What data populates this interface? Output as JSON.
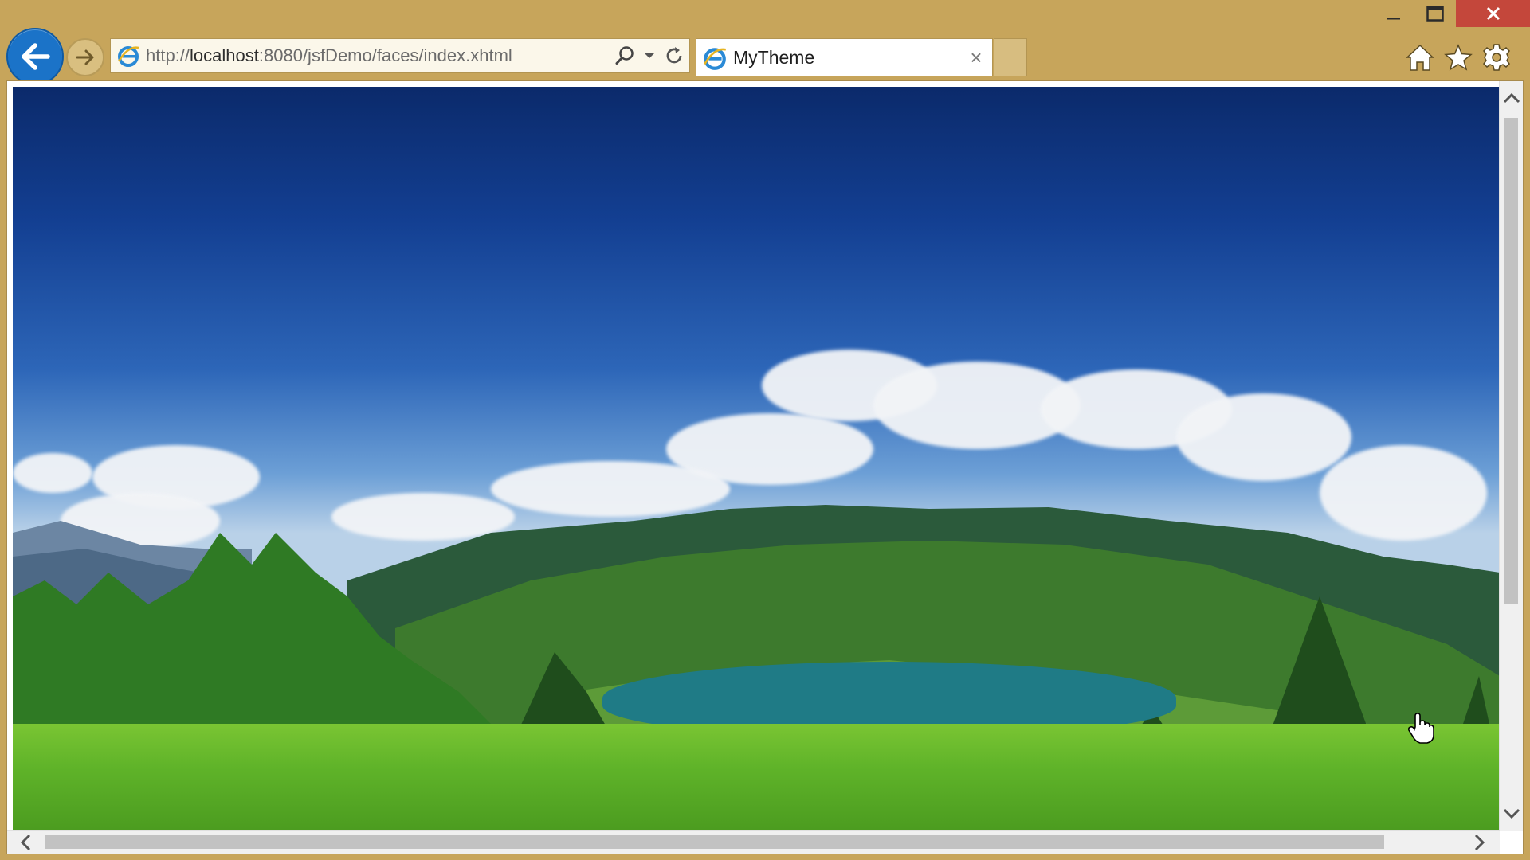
{
  "window": {
    "controls": {
      "minimize_icon": "minimize-icon",
      "maximize_icon": "maximize-icon",
      "close_icon": "close-icon"
    },
    "frame_color": "#c7a55b",
    "close_color": "#c4473b"
  },
  "navigation": {
    "back_icon": "back-arrow-icon",
    "forward_icon": "forward-arrow-icon"
  },
  "address_bar": {
    "url_prefix": "http://",
    "url_host": "localhost",
    "url_rest": ":8080/jsfDemo/faces/index.xhtml",
    "search_icon": "search-icon",
    "dropdown_icon": "chevron-down-icon",
    "refresh_icon": "refresh-icon"
  },
  "tabs": [
    {
      "title": "MyTheme",
      "active": true,
      "close_label": "×"
    }
  ],
  "toolbar": {
    "home_icon": "home-icon",
    "favorites_icon": "star-icon",
    "tools_icon": "gear-icon"
  },
  "page": {
    "image_subject": "mountain-lake-landscape"
  }
}
